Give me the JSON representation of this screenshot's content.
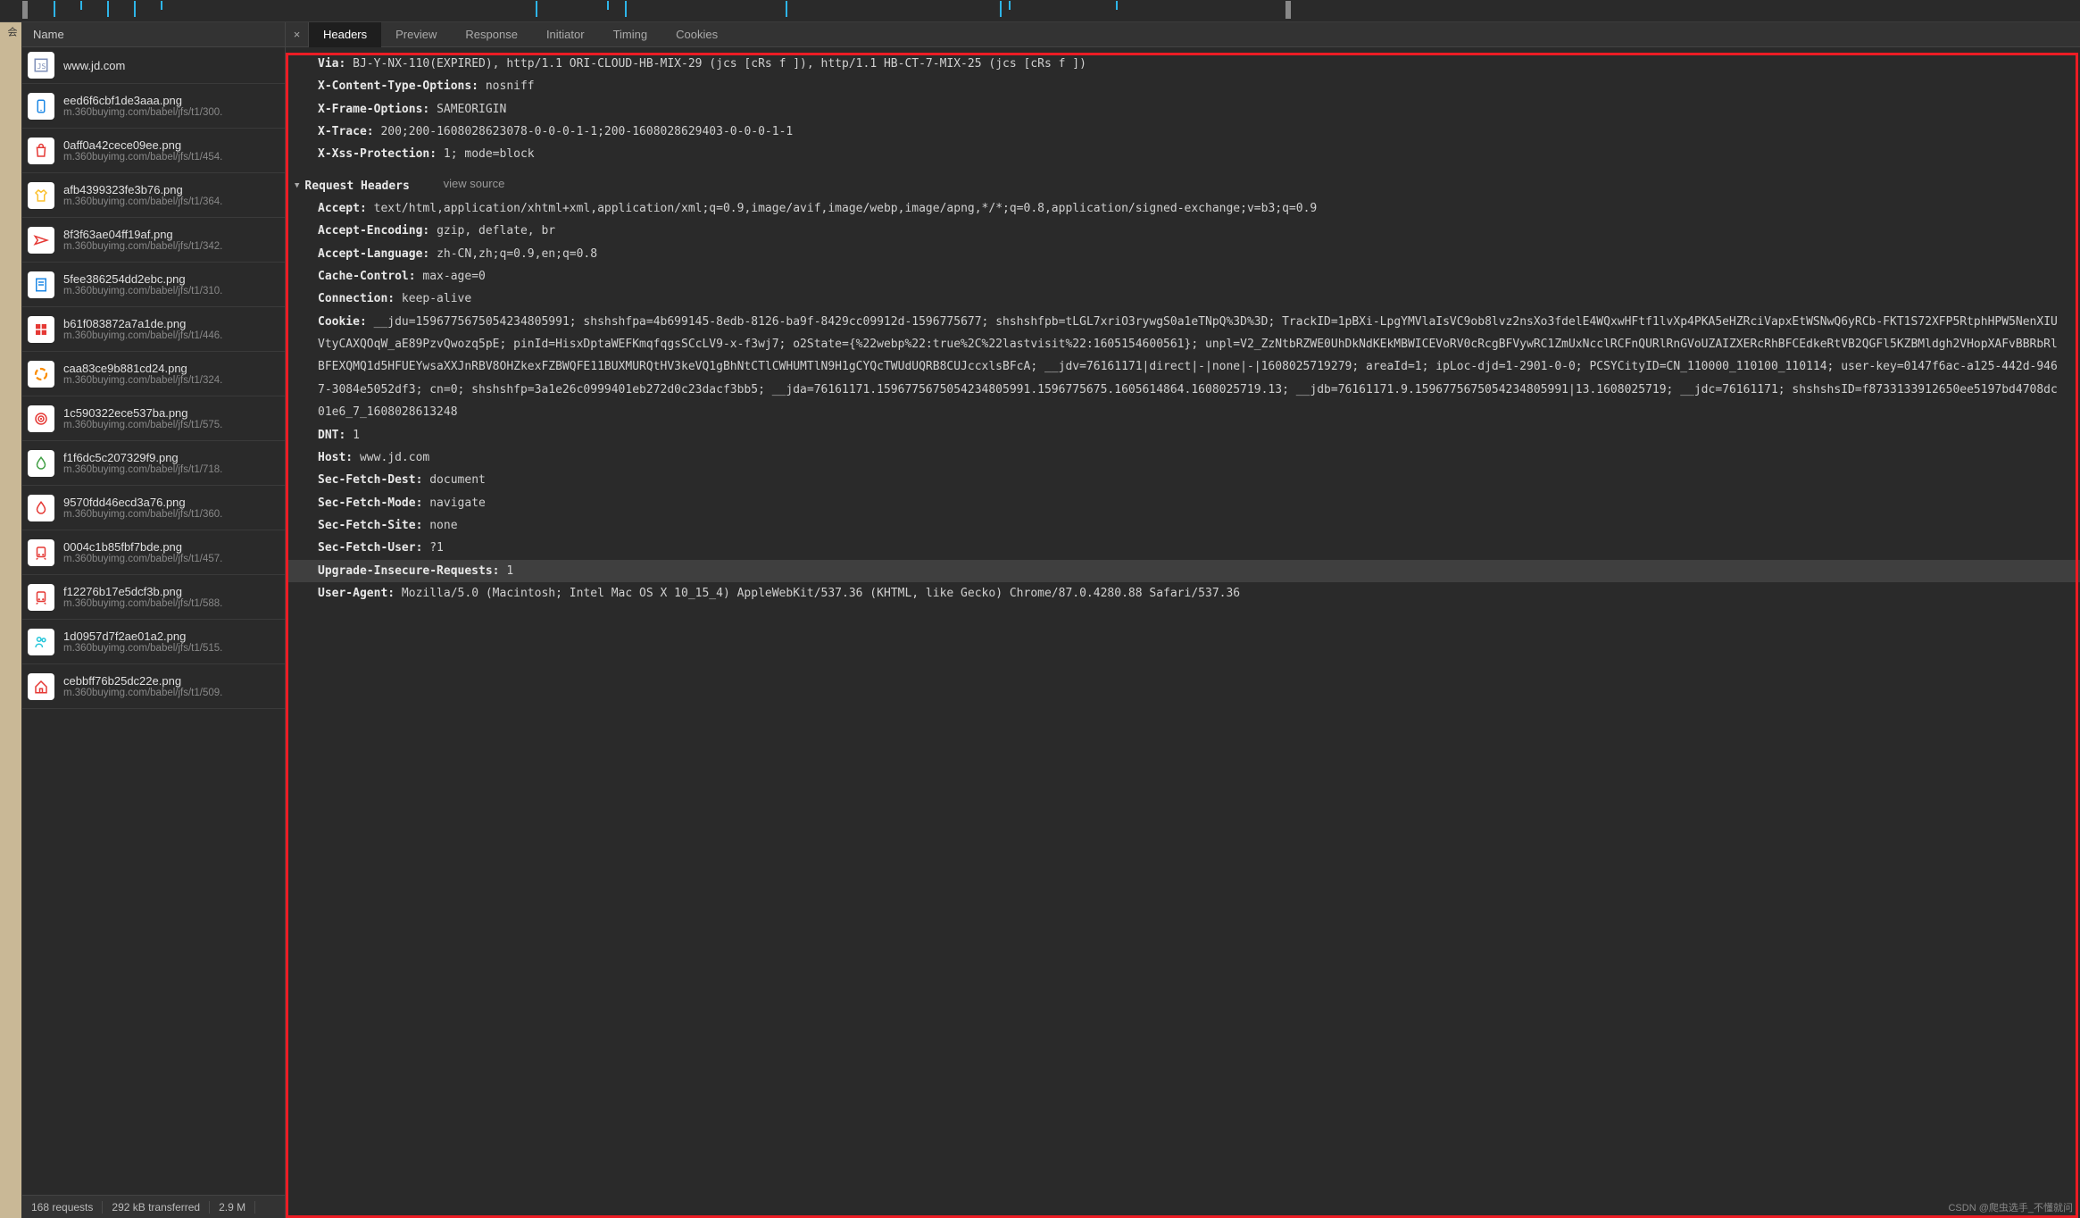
{
  "sidebar": {
    "header": "Name",
    "requests": [
      {
        "name": "www.jd.com",
        "sub": "",
        "icon": "script",
        "color": "#7e8fb8"
      },
      {
        "name": "eed6f6cbf1de3aaa.png",
        "sub": "m.360buyimg.com/babel/jfs/t1/300.",
        "icon": "phone",
        "color": "#1e88e5"
      },
      {
        "name": "0aff0a42cece09ee.png",
        "sub": "m.360buyimg.com/babel/jfs/t1/454.",
        "icon": "bag",
        "color": "#e53935"
      },
      {
        "name": "afb4399323fe3b76.png",
        "sub": "m.360buyimg.com/babel/jfs/t1/364.",
        "icon": "shirt",
        "color": "#fbc02d"
      },
      {
        "name": "8f3f63ae04ff19af.png",
        "sub": "m.360buyimg.com/babel/jfs/t1/342.",
        "icon": "plane",
        "color": "#e53935"
      },
      {
        "name": "5fee386254dd2ebc.png",
        "sub": "m.360buyimg.com/babel/jfs/t1/310.",
        "icon": "doc",
        "color": "#1e88e5"
      },
      {
        "name": "b61f083872a7a1de.png",
        "sub": "m.360buyimg.com/babel/jfs/t1/446.",
        "icon": "grid",
        "color": "#e53935"
      },
      {
        "name": "caa83ce9b881cd24.png",
        "sub": "m.360buyimg.com/babel/jfs/t1/324.",
        "icon": "circle",
        "color": "#fb8c00"
      },
      {
        "name": "1c590322ece537ba.png",
        "sub": "m.360buyimg.com/babel/jfs/t1/575.",
        "icon": "target",
        "color": "#e53935"
      },
      {
        "name": "f1f6dc5c207329f9.png",
        "sub": "m.360buyimg.com/babel/jfs/t1/718.",
        "icon": "drop",
        "color": "#43a047"
      },
      {
        "name": "9570fdd46ecd3a76.png",
        "sub": "m.360buyimg.com/babel/jfs/t1/360.",
        "icon": "drop",
        "color": "#e53935"
      },
      {
        "name": "0004c1b85fbf7bde.png",
        "sub": "m.360buyimg.com/babel/jfs/t1/457.",
        "icon": "train",
        "color": "#e53935"
      },
      {
        "name": "f12276b17e5dcf3b.png",
        "sub": "m.360buyimg.com/babel/jfs/t1/588.",
        "icon": "train",
        "color": "#e53935"
      },
      {
        "name": "1d0957d7f2ae01a2.png",
        "sub": "m.360buyimg.com/babel/jfs/t1/515.",
        "icon": "people",
        "color": "#26c6da"
      },
      {
        "name": "cebbff76b25dc22e.png",
        "sub": "m.360buyimg.com/babel/jfs/t1/509.",
        "icon": "house",
        "color": "#e53935"
      }
    ],
    "status": {
      "requests": "168 requests",
      "transferred": "292 kB transferred",
      "size": "2.9 M"
    }
  },
  "tabs": [
    "Headers",
    "Preview",
    "Response",
    "Initiator",
    "Timing",
    "Cookies"
  ],
  "activeTab": 0,
  "response_headers": [
    {
      "k": "Via:",
      "v": "BJ-Y-NX-110(EXPIRED), http/1.1 ORI-CLOUD-HB-MIX-29 (jcs [cRs f ]), http/1.1 HB-CT-7-MIX-25 (jcs [cRs f ])"
    },
    {
      "k": "X-Content-Type-Options:",
      "v": "nosniff"
    },
    {
      "k": "X-Frame-Options:",
      "v": "SAMEORIGIN"
    },
    {
      "k": "X-Trace:",
      "v": "200;200-1608028623078-0-0-0-1-1;200-1608028629403-0-0-0-1-1"
    },
    {
      "k": "X-Xss-Protection:",
      "v": "1; mode=block"
    }
  ],
  "request_section": {
    "title": "Request Headers",
    "view_source": "view source"
  },
  "request_headers": [
    {
      "k": "Accept:",
      "v": "text/html,application/xhtml+xml,application/xml;q=0.9,image/avif,image/webp,image/apng,*/*;q=0.8,application/signed-exchange;v=b3;q=0.9"
    },
    {
      "k": "Accept-Encoding:",
      "v": "gzip, deflate, br"
    },
    {
      "k": "Accept-Language:",
      "v": "zh-CN,zh;q=0.9,en;q=0.8"
    },
    {
      "k": "Cache-Control:",
      "v": "max-age=0"
    },
    {
      "k": "Connection:",
      "v": "keep-alive"
    },
    {
      "k": "Cookie:",
      "v": "__jdu=1596775675054234805991; shshshfpa=4b699145-8edb-8126-ba9f-8429cc09912d-1596775677; shshshfpb=tLGL7xriO3rywgS0a1eTNpQ%3D%3D; TrackID=1pBXi-LpgYMVlaIsVC9ob8lvz2nsXo3fdelE4WQxwHFtf1lvXp4PKA5eHZRciVapxEtWSNwQ6yRCb-FKT1S72XFP5RtphHPW5NenXIUVtyCAXQOqW_aE89PzvQwozq5pE; pinId=HisxDptaWEFKmqfqgsSCcLV9-x-f3wj7; o2State={%22webp%22:true%2C%22lastvisit%22:1605154600561}; unpl=V2_ZzNtbRZWE0UhDkNdKEkMBWICEVoRV0cRcgBFVywRC1ZmUxNcclRCFnQURlRnGVoUZAIZXERcRhBFCEdkeRtVB2QGFl5KZBMldgh2VHopXAFvBBRbRlBFEXQMQ1d5HFUEYwsaXXJnRBV8OHZkexFZBWQFE11BUXMURQtHV3keVQ1gBhNtCTlCWHUMTlN9H1gCYQcTWUdUQRB8CUJccxlsBFcA; __jdv=76161171|direct|-|none|-|1608025719279; areaId=1; ipLoc-djd=1-2901-0-0; PCSYCityID=CN_110000_110100_110114; user-key=0147f6ac-a125-442d-9467-3084e5052df3; cn=0; shshshfp=3a1e26c0999401eb272d0c23dacf3bb5; __jda=76161171.1596775675054234805991.1596775675.1605614864.1608025719.13; __jdb=76161171.9.1596775675054234805991|13.1608025719; __jdc=76161171; shshshsID=f8733133912650ee5197bd4708dc01e6_7_1608028613248"
    },
    {
      "k": "DNT:",
      "v": "1"
    },
    {
      "k": "Host:",
      "v": "www.jd.com"
    },
    {
      "k": "Sec-Fetch-Dest:",
      "v": "document"
    },
    {
      "k": "Sec-Fetch-Mode:",
      "v": "navigate"
    },
    {
      "k": "Sec-Fetch-Site:",
      "v": "none"
    },
    {
      "k": "Sec-Fetch-User:",
      "v": "?1"
    },
    {
      "k": "Upgrade-Insecure-Requests:",
      "v": "1",
      "hl": true
    },
    {
      "k": "User-Agent:",
      "v": "Mozilla/5.0 (Macintosh; Intel Mac OS X 10_15_4) AppleWebKit/537.36 (KHTML, like Gecko) Chrome/87.0.4280.88 Safari/537.36"
    }
  ],
  "watermark": "CSDN @爬虫选手_不懂就问",
  "left_label": "会"
}
